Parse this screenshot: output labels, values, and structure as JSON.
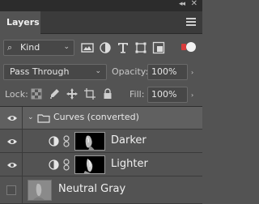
{
  "window": {
    "collapse_glyph": "◂◂",
    "close_glyph": "✕"
  },
  "panel": {
    "title": "Layers"
  },
  "filter": {
    "kind_label": "Kind",
    "icons": [
      "image-filter-icon",
      "adjustment-filter-icon",
      "type-filter-icon",
      "shape-filter-icon",
      "smart-object-filter-icon"
    ],
    "toggle_color": "#d83b3b"
  },
  "blend": {
    "mode": "Pass Through",
    "opacity_label": "Opacity:",
    "opacity_value": "100%"
  },
  "lock": {
    "label": "Lock:",
    "fill_label": "Fill:",
    "fill_value": "100%"
  },
  "layers": {
    "group": {
      "name": "Curves (converted)",
      "visible": true,
      "expanded": true
    },
    "adjustments": [
      {
        "name": "Darker",
        "visible": true
      },
      {
        "name": "Lighter",
        "visible": true
      }
    ],
    "background": {
      "name": "Neutral Gray",
      "visible": false
    }
  }
}
